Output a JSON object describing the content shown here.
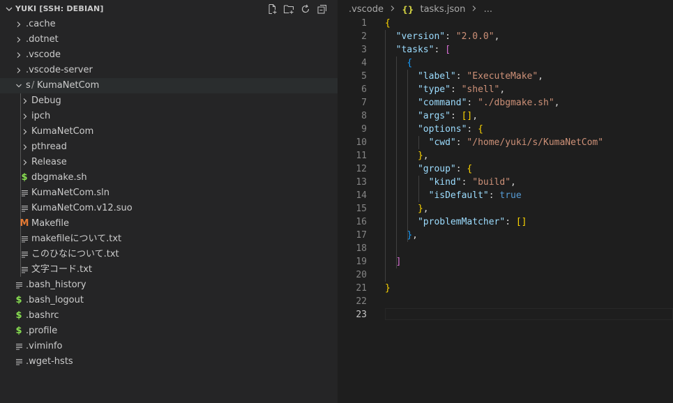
{
  "explorer": {
    "title": "YUKI [SSH: DEBIAN]",
    "actions": [
      "new-file",
      "new-folder",
      "refresh",
      "collapse-all"
    ],
    "items": [
      {
        "label": ".cache",
        "type": "folder",
        "state": "collapsed"
      },
      {
        "label": ".dotnet",
        "type": "folder",
        "state": "collapsed"
      },
      {
        "label": ".vscode",
        "type": "folder",
        "state": "collapsed"
      },
      {
        "label": ".vscode-server",
        "type": "folder",
        "state": "collapsed"
      },
      {
        "label": "s",
        "label2": "KumaNetCom",
        "type": "folder",
        "state": "expanded"
      },
      {
        "label": "Debug",
        "type": "folder",
        "state": "collapsed"
      },
      {
        "label": "ipch",
        "type": "folder",
        "state": "collapsed"
      },
      {
        "label": "KumaNetCom",
        "type": "folder",
        "state": "collapsed"
      },
      {
        "label": "pthread",
        "type": "folder",
        "state": "collapsed"
      },
      {
        "label": "Release",
        "type": "folder",
        "state": "collapsed"
      },
      {
        "label": "dbgmake.sh",
        "type": "shell"
      },
      {
        "label": "KumaNetCom.sln",
        "type": "text"
      },
      {
        "label": "KumaNetCom.v12.suo",
        "type": "text"
      },
      {
        "label": "Makefile",
        "type": "makefile"
      },
      {
        "label": "makefileについて.txt",
        "type": "text"
      },
      {
        "label": "このひなについて.txt",
        "type": "text"
      },
      {
        "label": "文字コード.txt",
        "type": "text"
      },
      {
        "label": ".bash_history",
        "type": "text"
      },
      {
        "label": ".bash_logout",
        "type": "shell"
      },
      {
        "label": ".bashrc",
        "type": "shell"
      },
      {
        "label": ".profile",
        "type": "shell"
      },
      {
        "label": ".viminfo",
        "type": "text"
      },
      {
        "label": ".wget-hsts",
        "type": "text"
      }
    ]
  },
  "breadcrumb": {
    "folder": ".vscode",
    "file_icon": "{}",
    "file": "tasks.json",
    "more": "..."
  },
  "editor": {
    "line_numbers": [
      "1",
      "2",
      "3",
      "4",
      "5",
      "6",
      "7",
      "8",
      "9",
      "10",
      "11",
      "12",
      "13",
      "14",
      "15",
      "16",
      "17",
      "18",
      "19",
      "20",
      "21",
      "22",
      "23"
    ],
    "current_line": "23",
    "lines": [
      [
        [
          "b1",
          "{"
        ]
      ],
      [
        [
          "w",
          "  "
        ],
        [
          "k",
          "\"version\""
        ],
        [
          "w",
          ": "
        ],
        [
          "s",
          "\"2.0.0\""
        ],
        [
          "w",
          ","
        ]
      ],
      [
        [
          "w",
          "  "
        ],
        [
          "k",
          "\"tasks\""
        ],
        [
          "w",
          ": "
        ],
        [
          "b2",
          "["
        ]
      ],
      [
        [
          "w",
          "    "
        ],
        [
          "b3",
          "{"
        ]
      ],
      [
        [
          "w",
          "      "
        ],
        [
          "k",
          "\"label\""
        ],
        [
          "w",
          ": "
        ],
        [
          "s",
          "\"ExecuteMake\""
        ],
        [
          "w",
          ","
        ]
      ],
      [
        [
          "w",
          "      "
        ],
        [
          "k",
          "\"type\""
        ],
        [
          "w",
          ": "
        ],
        [
          "s",
          "\"shell\""
        ],
        [
          "w",
          ","
        ]
      ],
      [
        [
          "w",
          "      "
        ],
        [
          "k",
          "\"command\""
        ],
        [
          "w",
          ": "
        ],
        [
          "s",
          "\"./dbgmake.sh\""
        ],
        [
          "w",
          ","
        ]
      ],
      [
        [
          "w",
          "      "
        ],
        [
          "k",
          "\"args\""
        ],
        [
          "w",
          ": "
        ],
        [
          "b1",
          "[]"
        ],
        [
          "w",
          ","
        ]
      ],
      [
        [
          "w",
          "      "
        ],
        [
          "k",
          "\"options\""
        ],
        [
          "w",
          ": "
        ],
        [
          "b1",
          "{"
        ]
      ],
      [
        [
          "w",
          "        "
        ],
        [
          "k",
          "\"cwd\""
        ],
        [
          "w",
          ": "
        ],
        [
          "s",
          "\"/home/yuki/s/KumaNetCom\""
        ]
      ],
      [
        [
          "w",
          "      "
        ],
        [
          "b1",
          "}"
        ],
        [
          "w",
          ","
        ]
      ],
      [
        [
          "w",
          "      "
        ],
        [
          "k",
          "\"group\""
        ],
        [
          "w",
          ": "
        ],
        [
          "b1",
          "{"
        ]
      ],
      [
        [
          "w",
          "        "
        ],
        [
          "k",
          "\"kind\""
        ],
        [
          "w",
          ": "
        ],
        [
          "s",
          "\"build\""
        ],
        [
          "w",
          ","
        ]
      ],
      [
        [
          "w",
          "        "
        ],
        [
          "k",
          "\"isDefault\""
        ],
        [
          "w",
          ": "
        ],
        [
          "n",
          "true"
        ]
      ],
      [
        [
          "w",
          "      "
        ],
        [
          "b1",
          "}"
        ],
        [
          "w",
          ","
        ]
      ],
      [
        [
          "w",
          "      "
        ],
        [
          "k",
          "\"problemMatcher\""
        ],
        [
          "w",
          ": "
        ],
        [
          "b1",
          "[]"
        ]
      ],
      [
        [
          "w",
          "    "
        ],
        [
          "b3",
          "}"
        ],
        [
          "w",
          ","
        ]
      ],
      [
        [
          "w",
          ""
        ]
      ],
      [
        [
          "w",
          "  "
        ],
        [
          "b2",
          "]"
        ]
      ],
      [
        [
          "w",
          ""
        ]
      ],
      [
        [
          "b1",
          "}"
        ]
      ],
      [
        [
          "w",
          ""
        ]
      ],
      [
        [
          "w",
          ""
        ]
      ]
    ]
  },
  "colors": {
    "sidebar_bg": "#252526",
    "editor_bg": "#1e1e1e",
    "folder_chevron": "#c5c5c5",
    "shell_icon": "#89e051",
    "makefile_icon": "#e37933",
    "json_icon": "#cbcb41"
  }
}
